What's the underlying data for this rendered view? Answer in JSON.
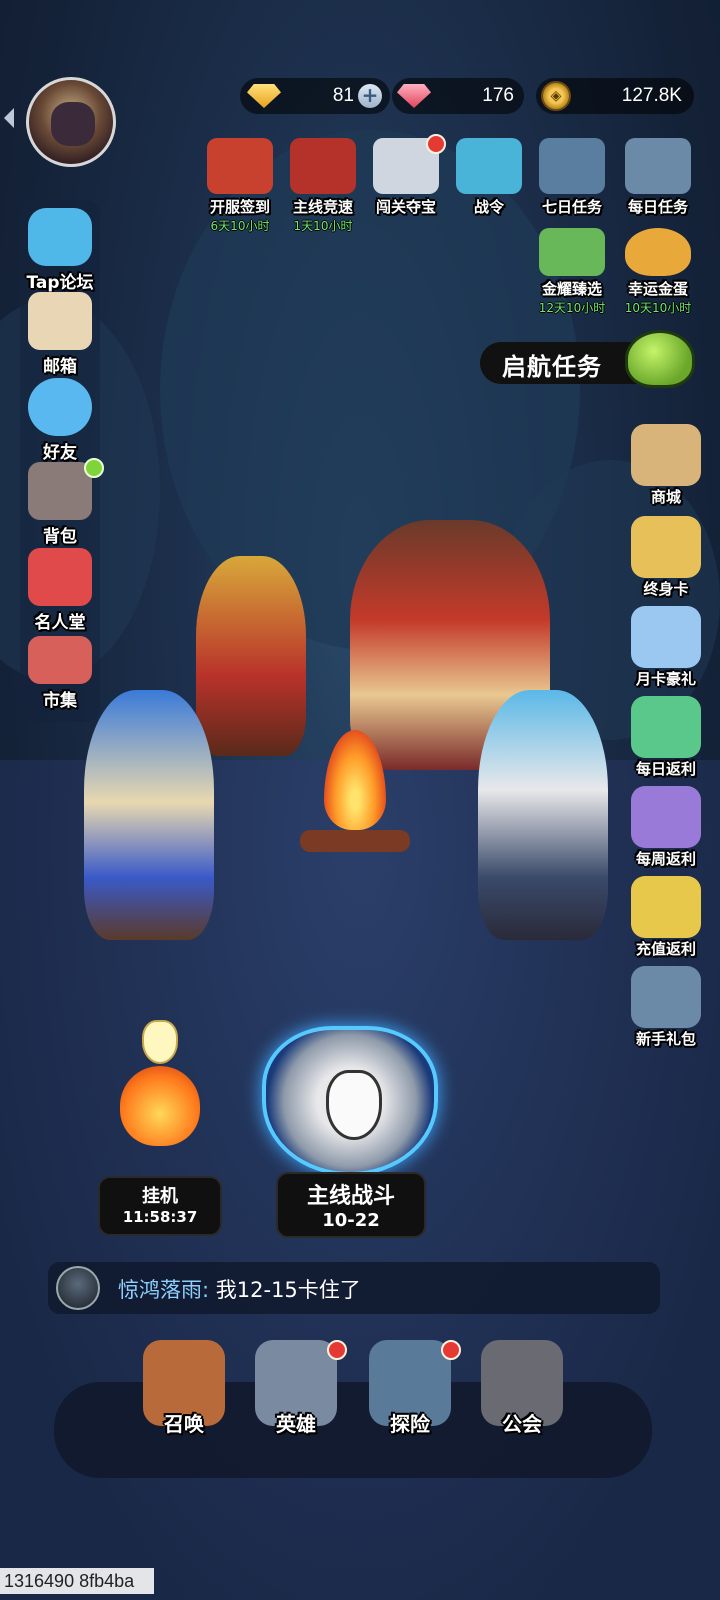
{
  "resources": {
    "gold_gem": {
      "icon": "gold-diamond-icon",
      "value": "81",
      "has_plus": true
    },
    "red_gem": {
      "icon": "red-diamond-icon",
      "value": "176"
    },
    "coins": {
      "icon": "gold-coin-icon",
      "value": "127.8K"
    }
  },
  "player": {
    "avatar": "player-avatar"
  },
  "left_menu": [
    {
      "label": "Tap论坛",
      "icon": "chat-bubble-icon",
      "color": "#4fb8e8"
    },
    {
      "label": "邮箱",
      "icon": "envelope-icon",
      "color": "#e8d6b4"
    },
    {
      "label": "好友",
      "icon": "friends-icon",
      "color": "#5ab8f0"
    },
    {
      "label": "背包",
      "icon": "backpack-icon",
      "color": "#8a7a78",
      "dot": "green"
    },
    {
      "label": "名人堂",
      "icon": "hall-of-fame-icon",
      "color": "#e04a4a"
    },
    {
      "label": "市集",
      "icon": "market-stall-icon",
      "color": "#d8605a"
    }
  ],
  "top_features": [
    {
      "label": "开服签到",
      "timer": "6天10小时",
      "icon": "calendar-icon",
      "color": "#c8412e"
    },
    {
      "label": "主线竞速",
      "timer": "1天10小时",
      "icon": "trophy-shield-icon",
      "color": "#b4322a"
    },
    {
      "label": "闯关夺宝",
      "icon": "wolf-emblem-icon",
      "color": "#cfd6e0",
      "dot": "red"
    },
    {
      "label": "战令",
      "icon": "battle-pass-icon",
      "color": "#4ab4d8"
    },
    {
      "label": "七日任务",
      "icon": "helmet-icon",
      "color": "#5a7ea0"
    },
    {
      "label": "每日任务",
      "icon": "quest-book-icon",
      "color": "#6a8aa8"
    }
  ],
  "second_row_features": [
    {
      "label": "金耀臻选",
      "timer": "12天10小时",
      "icon": "green-calendar-icon",
      "color": "#68b85a"
    },
    {
      "label": "幸运金蛋",
      "timer": "10天10小时",
      "icon": "golden-egg-icon",
      "color": "#e8a83a"
    }
  ],
  "voyage_quest": {
    "label": "启航任务",
    "icon": "slime-icon"
  },
  "right_menu": [
    {
      "label": "商城",
      "icon": "shop-bag-icon",
      "color": "#d8b47a"
    },
    {
      "label": "终身卡",
      "icon": "crown-card-icon",
      "color": "#e8c05a"
    },
    {
      "label": "月卡豪礼",
      "icon": "ssr-card-icon",
      "color": "#9ac8f0"
    },
    {
      "label": "每日返利",
      "icon": "gift-box-icon",
      "color": "#5ac88a"
    },
    {
      "label": "每周返利",
      "icon": "weekly-gift-icon",
      "color": "#9a7ad8"
    },
    {
      "label": "充值返利",
      "icon": "match-ticket-icon",
      "color": "#e8c84a"
    },
    {
      "label": "新手礼包",
      "icon": "starter-pack-icon",
      "color": "#6a8aa8"
    }
  ],
  "idle": {
    "title": "挂机",
    "time": "11:58:37"
  },
  "main_battle": {
    "title": "主线战斗",
    "stage": "10-22"
  },
  "chat": {
    "name": "惊鸿落雨:",
    "message": "我12-15卡住了"
  },
  "bottom_nav": [
    {
      "label": "召唤",
      "icon": "summon-helmet-icon",
      "color": "#b86a3a"
    },
    {
      "label": "英雄",
      "icon": "hero-emblem-icon",
      "color": "#7a8aa0",
      "dot": "red"
    },
    {
      "label": "探险",
      "icon": "compass-icon",
      "color": "#5a7a9a",
      "dot": "red"
    },
    {
      "label": "公会",
      "icon": "guild-star-icon",
      "color": "#6a6a72"
    }
  ],
  "footer": {
    "id": "1316490 8fb4ba"
  }
}
